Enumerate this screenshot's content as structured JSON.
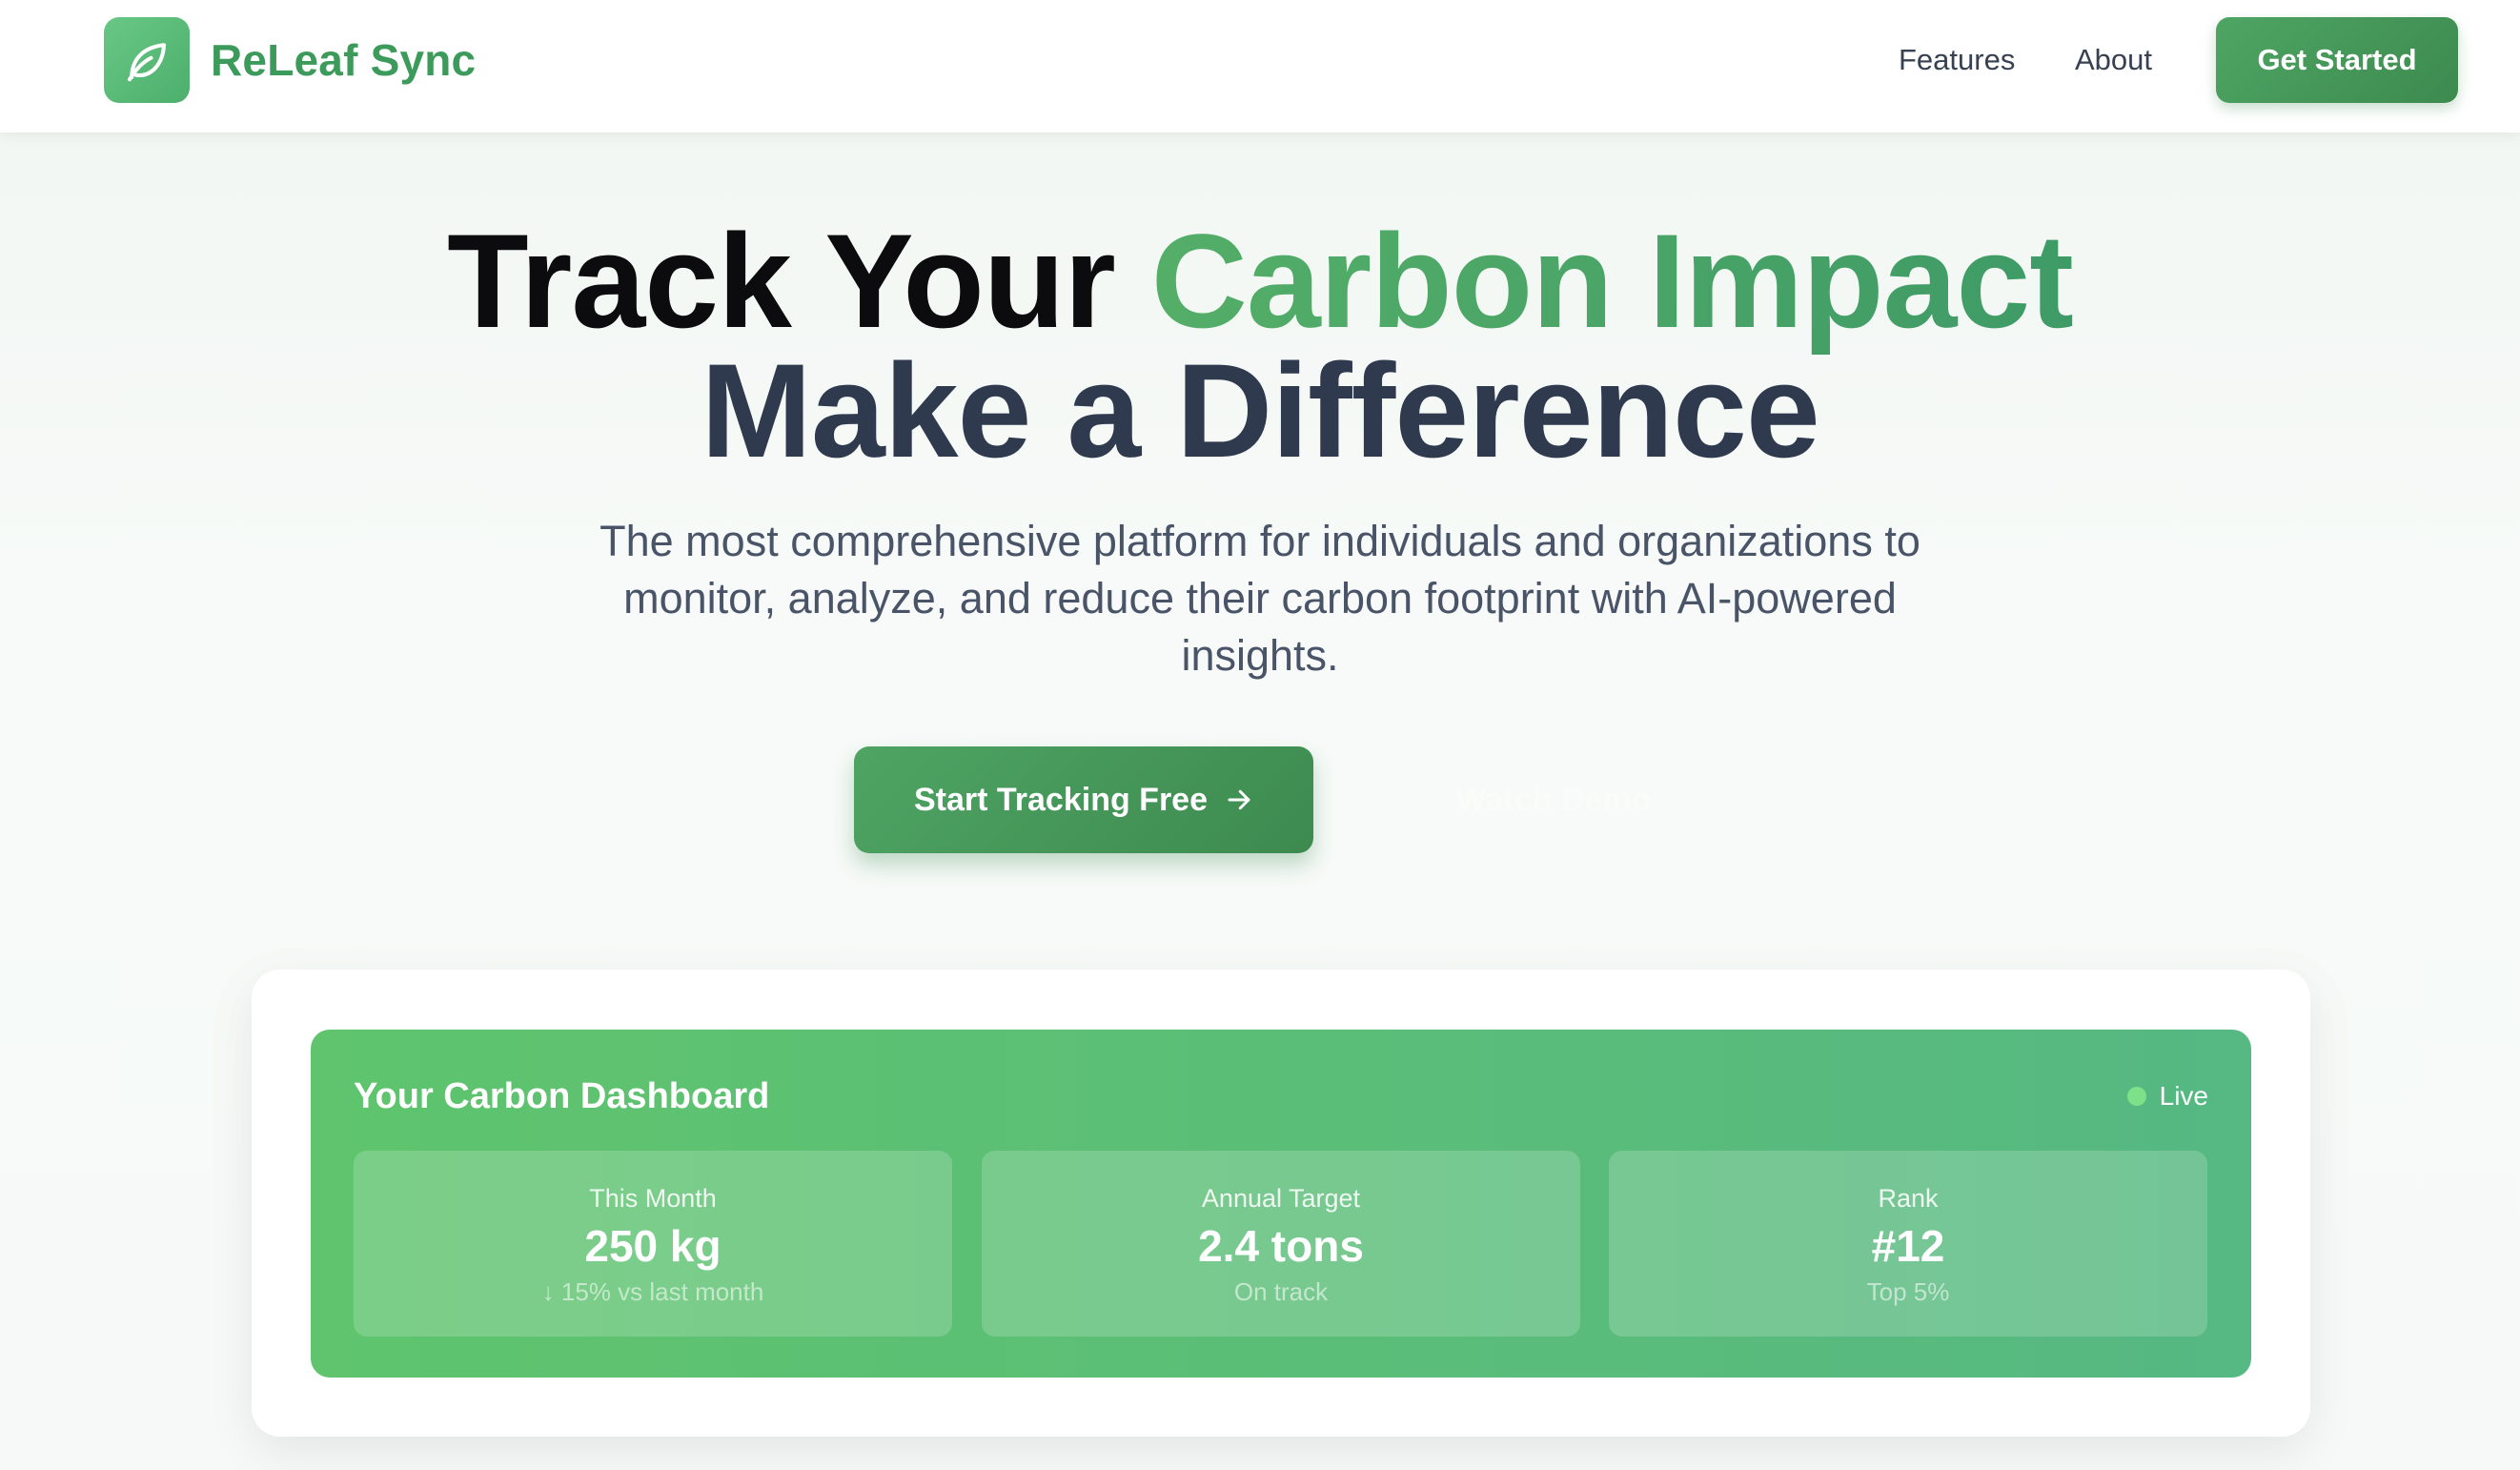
{
  "colors": {
    "brand_green": "#4caf6c",
    "dark_text": "#0c0c0f",
    "heading_slate": "#2f3a4f",
    "dashboard_green": "#5fc46d",
    "live_dot": "#7fe08a"
  },
  "nav": {
    "logo_icon": "leaf-icon",
    "brand": "ReLeaf Sync",
    "links": [
      "Features",
      "About"
    ],
    "cta": "Get Started"
  },
  "hero": {
    "title_part1": "Track Your",
    "title_highlight": "Carbon Impact",
    "title_line2": "Make a Difference",
    "subtitle": "The most comprehensive platform for individuals and organizations to monitor, analyze, and reduce their carbon footprint with AI-powered insights.",
    "primary_cta": "Start Tracking Free",
    "primary_cta_icon": "arrow-right-icon",
    "secondary_cta": "Watch Demo"
  },
  "dashboard": {
    "title": "Your Carbon Dashboard",
    "status": "Live",
    "stats": [
      {
        "label": "This Month",
        "value": "250 kg",
        "note": "↓ 15% vs last month"
      },
      {
        "label": "Annual Target",
        "value": "2.4 tons",
        "note": "On track"
      },
      {
        "label": "Rank",
        "value": "#12",
        "note": "Top 5%"
      }
    ]
  }
}
